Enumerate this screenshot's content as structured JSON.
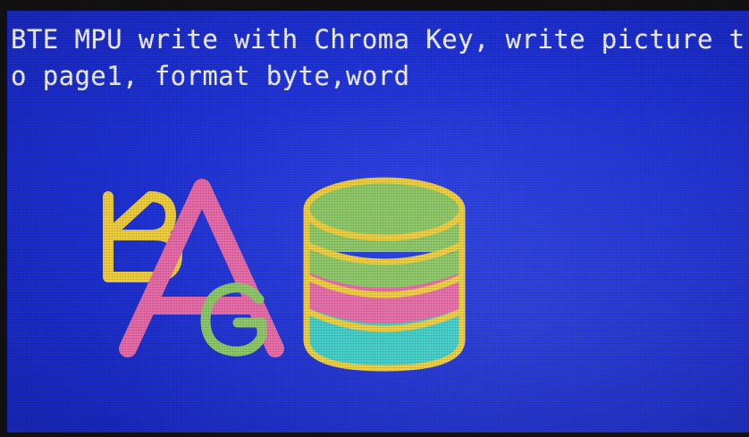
{
  "screen": {
    "caption": "BTE MPU write with Chroma Key, write picture to page1, format byte,word",
    "background_color": "#1f33d8"
  },
  "pictures": {
    "letters": {
      "icon": "letters-b-a-g-icon",
      "B_color": "#f0cf3c",
      "A_color": "#e86aa8",
      "G_color": "#8cc865"
    },
    "database": {
      "icon": "database-cylinder-icon",
      "outline_color": "#f0cf3c",
      "band_colors": [
        "#8cc865",
        "#e86aa8",
        "#3ecfc8"
      ]
    }
  }
}
